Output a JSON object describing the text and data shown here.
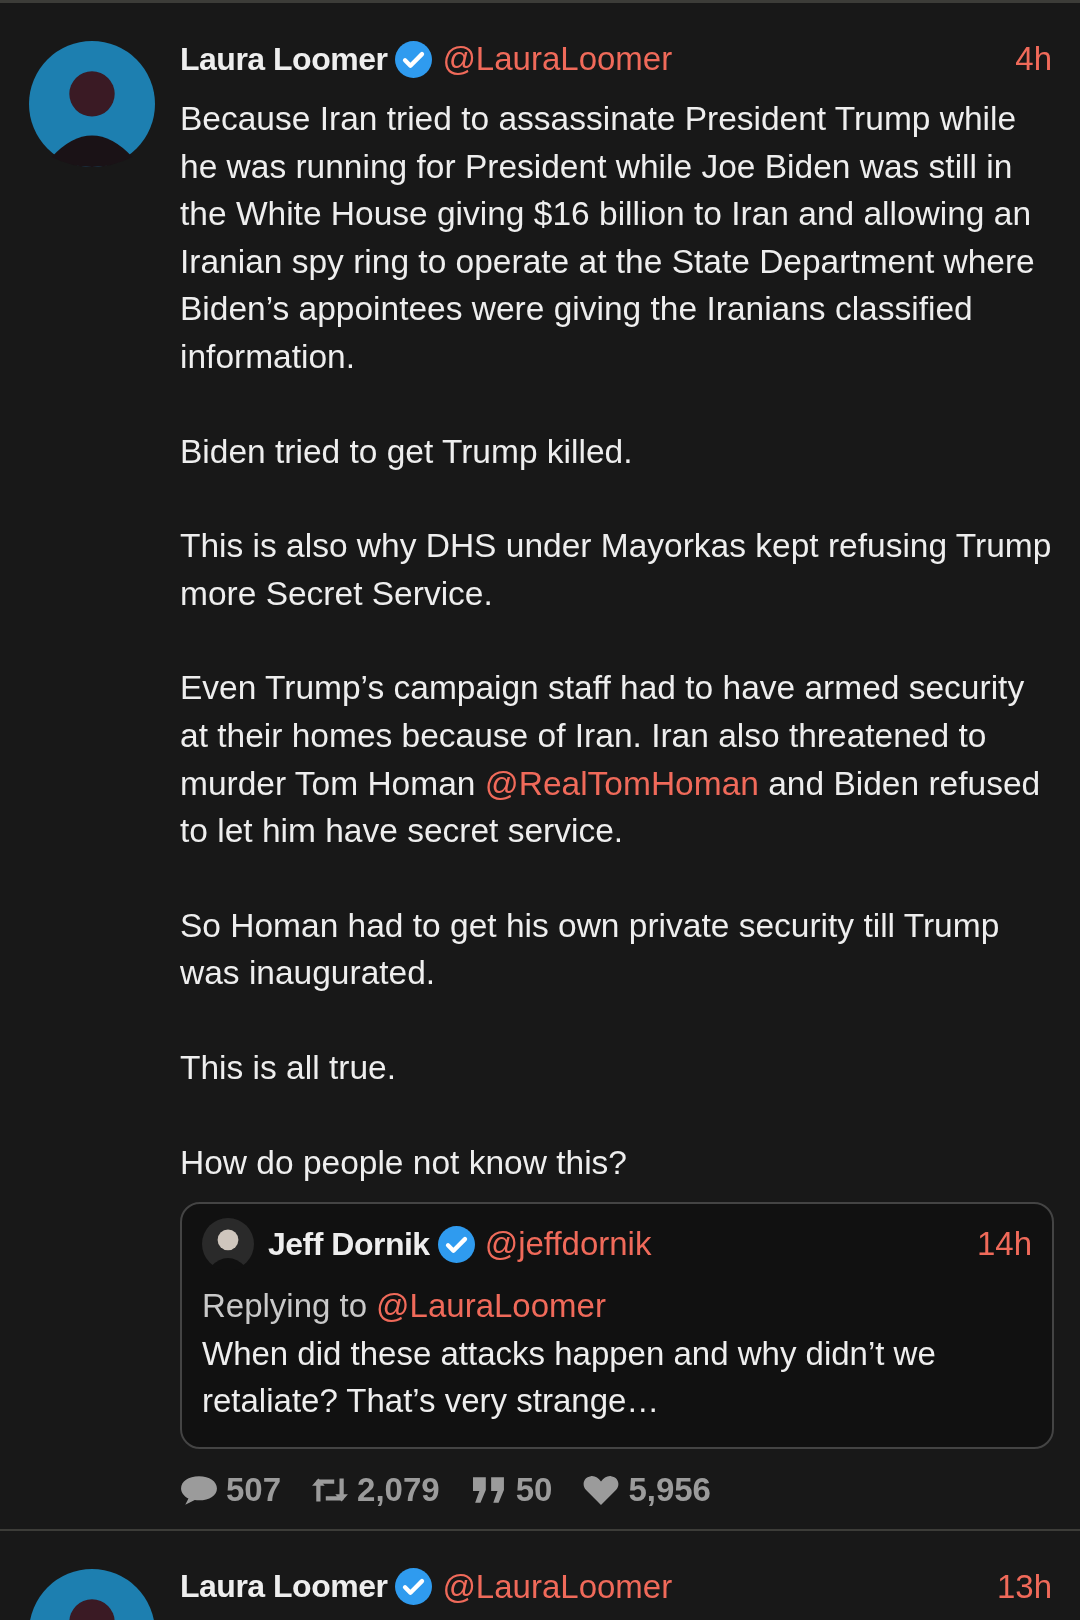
{
  "posts": [
    {
      "author": {
        "name": "Laura Loomer",
        "verified": true,
        "handle": "@LauraLoomer"
      },
      "time": "4h",
      "paragraphs": [
        [
          {
            "text": "Because Iran tried to assassinate President Trump while he was running for President while Joe Biden was still in the White House giving $16 billion to Iran and allowing an Iranian spy ring to operate at the State Department where Biden’s appointees were giving the Iranians classified information."
          }
        ],
        [
          {
            "text": "Biden tried to get Trump killed."
          }
        ],
        [
          {
            "text": "This is also why DHS under Mayorkas kept refusing Trump more Secret Service."
          }
        ],
        [
          {
            "text": "Even Trump’s campaign staff had to have armed security at their homes because of Iran. Iran also threatened to murder Tom Homan "
          },
          {
            "text": "@RealTomHoman",
            "kind": "mention"
          },
          {
            "text": " and Biden refused to let him have secret service."
          }
        ],
        [
          {
            "text": "So Homan had to get his own private security till Trump was inaugurated."
          }
        ],
        [
          {
            "text": "This is all true."
          }
        ],
        [
          {
            "text": "How do people not know this?"
          }
        ]
      ],
      "quote": {
        "author": {
          "name": "Jeff Dornik",
          "verified": true,
          "handle": "@jeffdornik"
        },
        "time": "14h",
        "replying_label": "Replying to",
        "replying_to": "@LauraLoomer",
        "text": "When did these attacks happen and why didn’t we retaliate? That’s very strange…"
      },
      "stats": [
        {
          "kind": "replies",
          "value": "507"
        },
        {
          "kind": "reposts",
          "value": "2,079"
        },
        {
          "kind": "quotes",
          "value": "50"
        },
        {
          "kind": "likes",
          "value": "5,956"
        }
      ]
    },
    {
      "author": {
        "name": "Laura Loomer",
        "verified": true,
        "handle": "@LauraLoomer"
      },
      "time": "13h"
    }
  ]
}
